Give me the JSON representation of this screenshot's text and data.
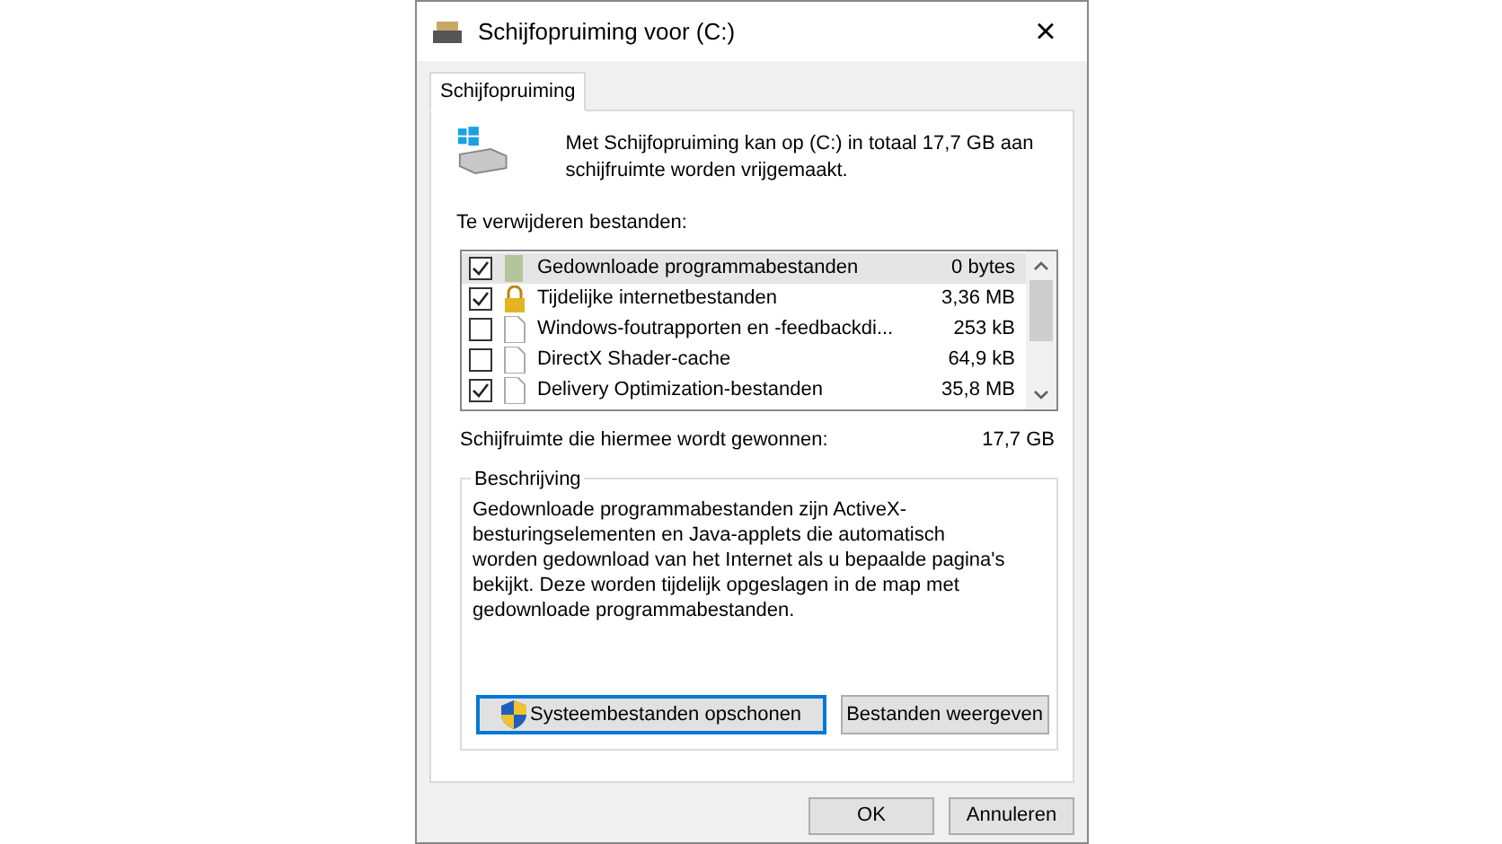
{
  "window": {
    "title": "Schijfopruiming voor  (C:)",
    "close": "×"
  },
  "tabs": [
    {
      "label": "Schijfopruiming",
      "selected": true
    }
  ],
  "intro": "Met Schijfopruiming kan op  (C:) in totaal 17,7 GB aan schijfruimte worden vrijgemaakt.",
  "files_label": "Te verwijderen bestanden:",
  "files": [
    {
      "name": "Gedownloade programmabestanden",
      "size": "0 bytes",
      "checked": true,
      "selected": true,
      "kind": "block"
    },
    {
      "name": "Tijdelijke internetbestanden",
      "size": "3,36 MB",
      "checked": true,
      "selected": false,
      "kind": "lock"
    },
    {
      "name": "Windows-foutrapporten en -feedbackdi...",
      "size": "253 kB",
      "checked": false,
      "selected": false,
      "kind": "page"
    },
    {
      "name": "DirectX Shader-cache",
      "size": "64,9 kB",
      "checked": false,
      "selected": false,
      "kind": "page"
    },
    {
      "name": "Delivery Optimization-bestanden",
      "size": "35,8 MB",
      "checked": true,
      "selected": false,
      "kind": "page"
    }
  ],
  "gain": {
    "label": "Schijfruimte die hiermee wordt gewonnen:",
    "value": "17,7 GB"
  },
  "description": {
    "legend": "Beschrijving",
    "text": "Gedownloade programmabestanden zijn ActiveX-besturingselementen en Java-applets die automatisch worden gedownload van het Internet als u bepaalde pagina's bekijkt. Deze worden tijdelijk opgeslagen in de map met gedownloade programmabestanden."
  },
  "actions": [
    {
      "label": "Systeembestanden opschonen",
      "kind": "shield"
    },
    {
      "label": "Bestanden weergeven",
      "kind": "plain"
    }
  ],
  "buttons": [
    "OK",
    "Annuleren"
  ]
}
